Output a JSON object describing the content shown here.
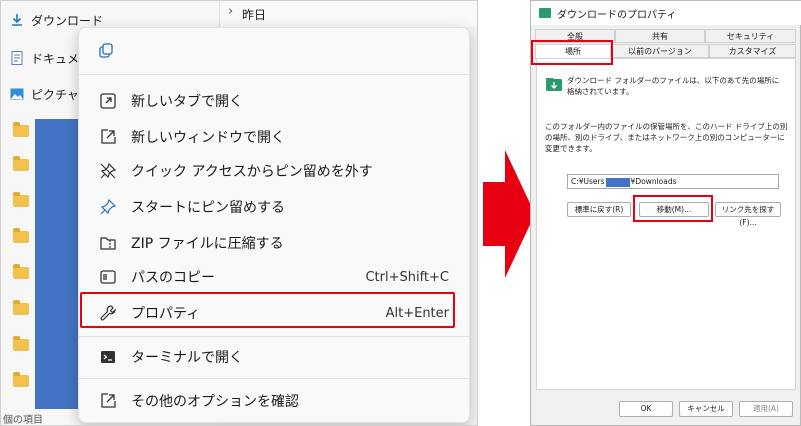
{
  "explorer": {
    "nav_items": [
      "ダウンロード",
      "ドキュメン",
      "ピクチャ"
    ],
    "top_label": "昨日",
    "footer": "個の項目",
    "accent_color": "#4472c4"
  },
  "context_menu": {
    "items": [
      {
        "label": "新しいタブで開く",
        "icon": "new-tab-icon",
        "shortcut": ""
      },
      {
        "label": "新しいウィンドウで開く",
        "icon": "new-window-icon",
        "shortcut": ""
      },
      {
        "label": "クイック アクセスからピン留めを外す",
        "icon": "unpin-icon",
        "shortcut": ""
      },
      {
        "label": "スタートにピン留めする",
        "icon": "pin-icon",
        "shortcut": ""
      },
      {
        "label": "ZIP ファイルに圧縮する",
        "icon": "zip-icon",
        "shortcut": ""
      },
      {
        "label": "パスのコピー",
        "icon": "copy-path-icon",
        "shortcut": "Ctrl+Shift+C"
      },
      {
        "label": "プロパティ",
        "icon": "wrench-icon",
        "shortcut": "Alt+Enter"
      },
      {
        "label": "ターミナルで開く",
        "icon": "terminal-icon",
        "shortcut": ""
      },
      {
        "label": "その他のオプションを確認",
        "icon": "more-options-icon",
        "shortcut": ""
      }
    ],
    "highlight_color": "#e60012"
  },
  "dialog": {
    "title": "ダウンロードのプロパティ",
    "tabs_row1": [
      "全般",
      "共有",
      "セキュリティ"
    ],
    "tabs_row2": [
      "場所",
      "以前のバージョン",
      "カスタマイズ"
    ],
    "description": "ダウンロード フォルダーのファイルは、以下のあて先の場所に格納されています。",
    "info": "このフォルダー内のファイルの保管場所を、このハード ドライブ上の別の場所、別のドライブ、またはネットワーク上の別のコンピューターに変更できます。",
    "path_prefix": "C:¥Users",
    "path_suffix": "¥Downloads",
    "buttons": {
      "restore": "標準に戻す(R)",
      "move": "移動(M)...",
      "find": "リンク先を探す(F)..."
    },
    "footer_buttons": {
      "ok": "OK",
      "cancel": "キャンセル",
      "apply": "適用(A)"
    }
  }
}
